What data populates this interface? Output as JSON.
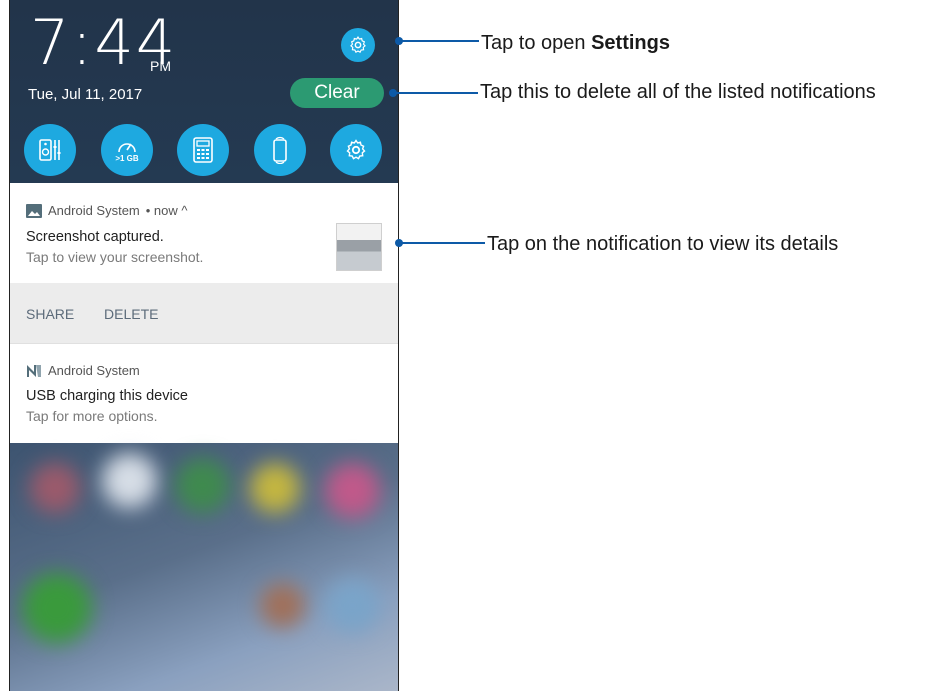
{
  "status": {
    "time": "7:44",
    "ampm": "PM",
    "date": "Tue, Jul 11, 2017",
    "clear_label": "Clear"
  },
  "quick_settings": [
    {
      "name": "audio-wizard-icon"
    },
    {
      "name": "memory-boost-icon",
      "label": ">1 GB"
    },
    {
      "name": "calculator-icon"
    },
    {
      "name": "auto-rotate-icon"
    },
    {
      "name": "settings-icon"
    }
  ],
  "notifications": [
    {
      "app": "Android System",
      "meta": "• now ^",
      "title": "Screenshot captured.",
      "text": "Tap to view your screenshot.",
      "actions": [
        "SHARE",
        "DELETE"
      ]
    },
    {
      "app": "Android System",
      "title": "USB charging this device",
      "text": "Tap for more options."
    }
  ],
  "annotations": {
    "settings_prefix": "Tap to open ",
    "settings_bold": "Settings",
    "clear": "Tap this to delete all of the listed notifications",
    "notification": "Tap on the notification to view its details"
  },
  "colors": {
    "accent": "#1ea9e0",
    "clear_button": "#2c9a72",
    "callout_line": "#0d5aa7"
  }
}
